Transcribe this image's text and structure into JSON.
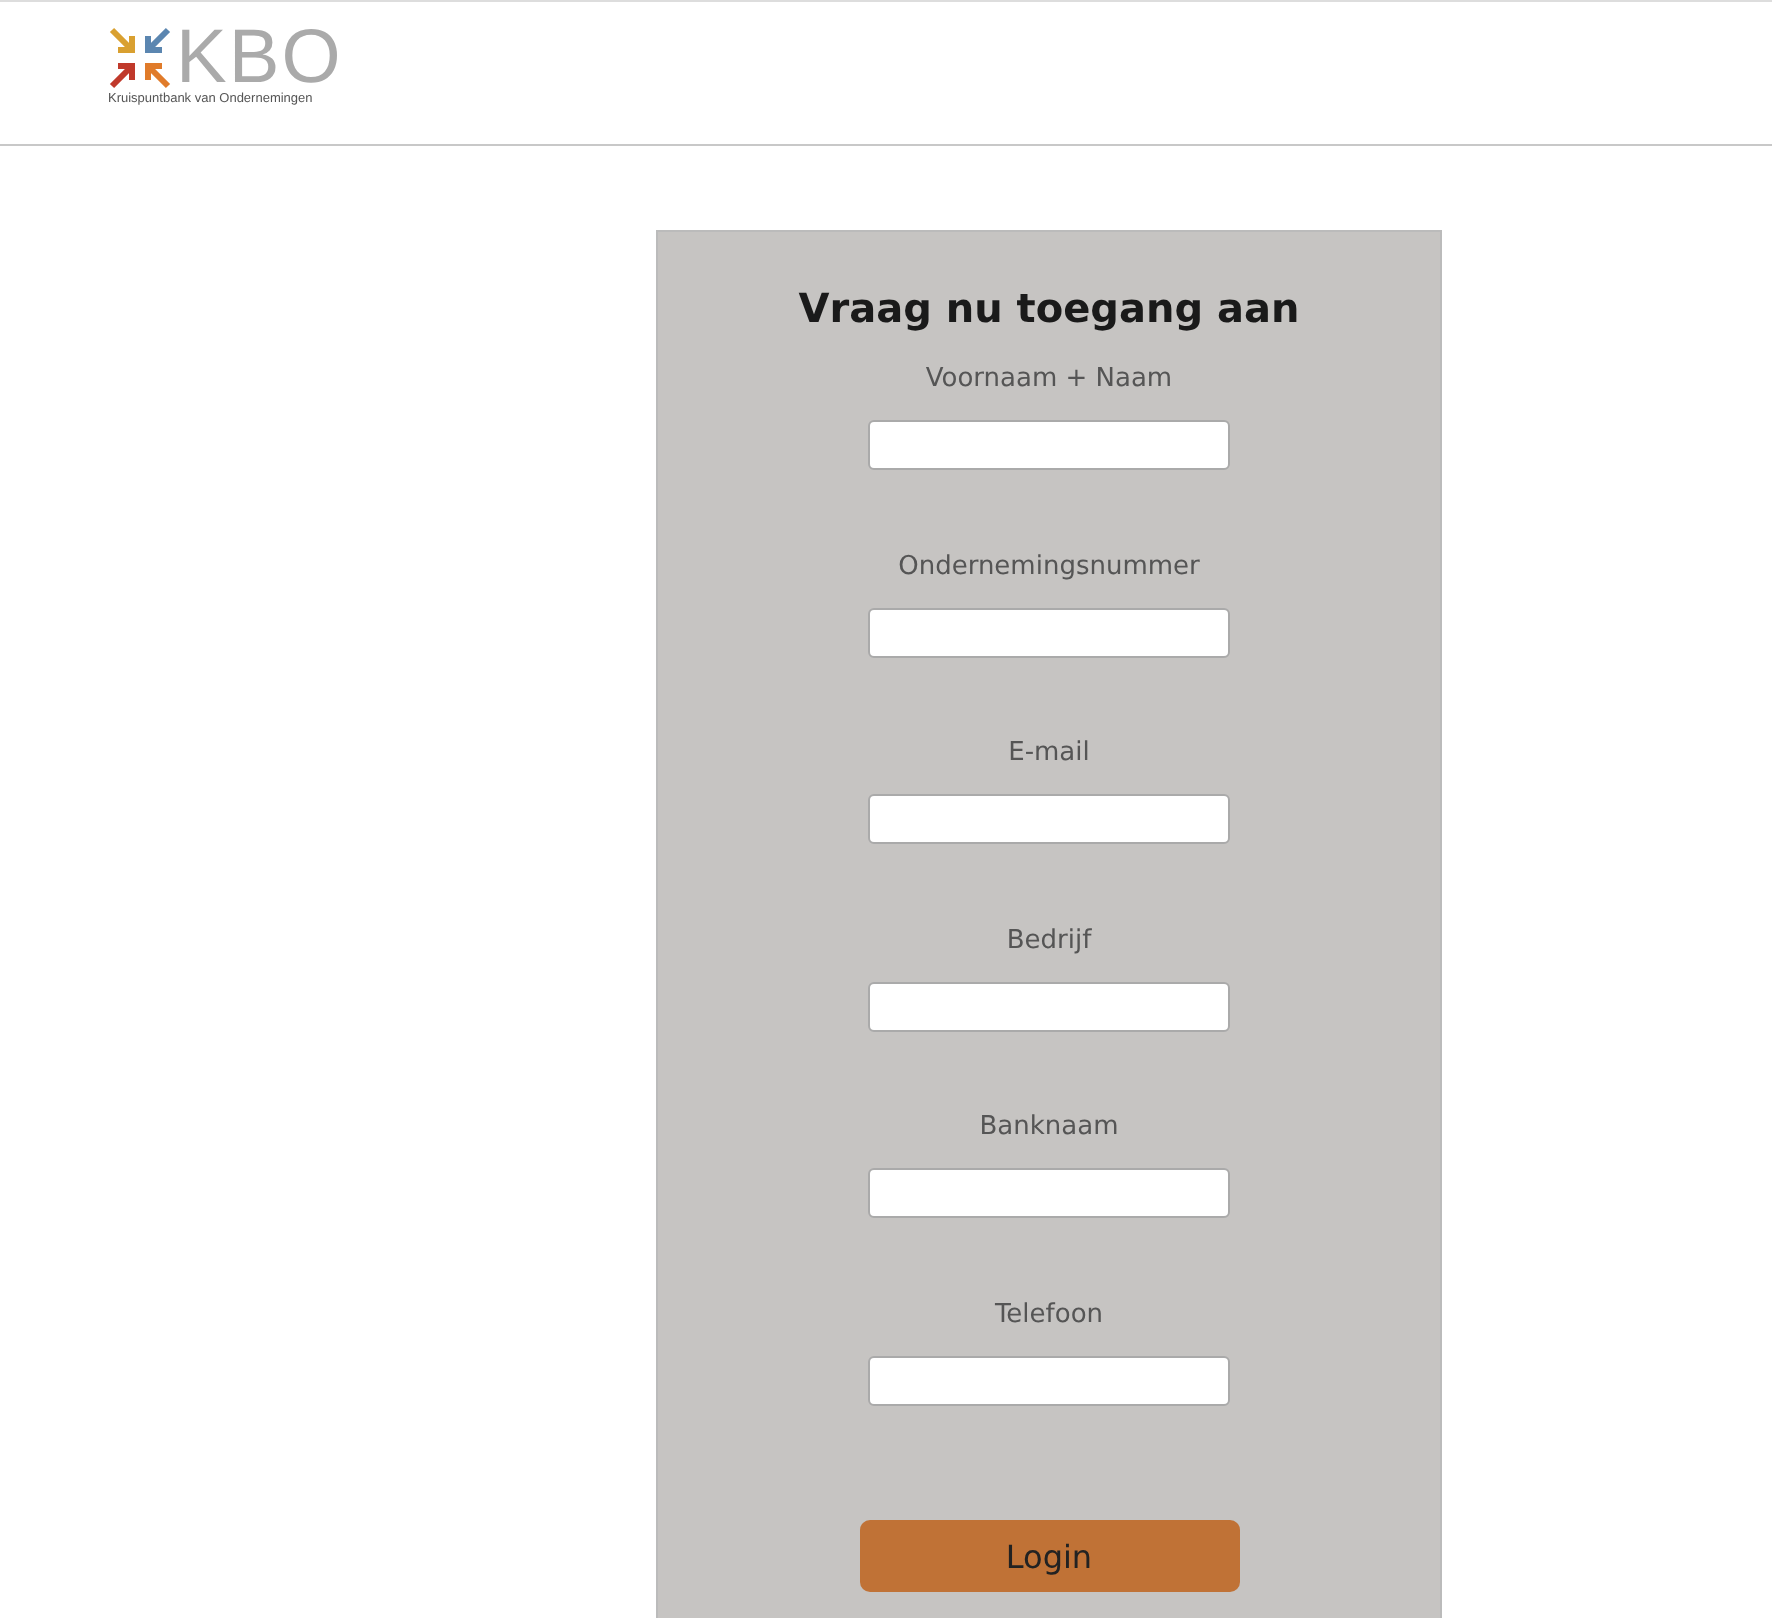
{
  "logo": {
    "wordmark": "KBO",
    "subtitle": "Kruispuntbank van Ondernemingen"
  },
  "form": {
    "title": "Vraag nu toegang aan",
    "fields": [
      {
        "label": "Voornaam + Naam"
      },
      {
        "label": "Ondernemingsnummer"
      },
      {
        "label": "E-mail"
      },
      {
        "label": "Bedrijf"
      },
      {
        "label": "Banknaam"
      },
      {
        "label": "Telefoon"
      }
    ],
    "submit": "Login"
  }
}
